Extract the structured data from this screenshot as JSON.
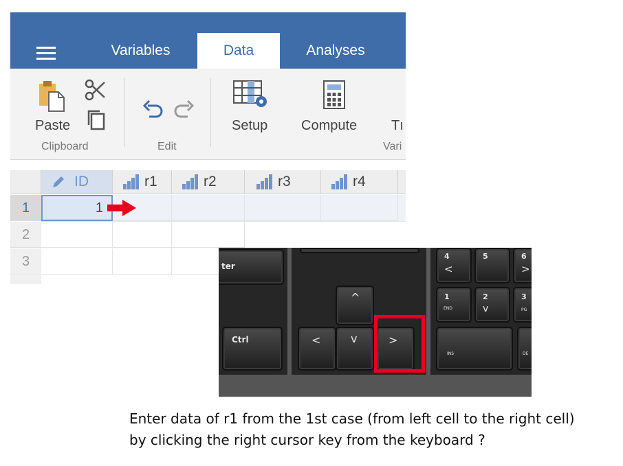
{
  "tabs": {
    "variables": "Variables",
    "data": "Data",
    "analyses": "Analyses"
  },
  "ribbon": {
    "paste": "Paste",
    "clipboard_group": "Clipboard",
    "edit_group": "Edit",
    "setup": "Setup",
    "compute": "Compute",
    "truncated_button": "Tı",
    "truncated_group": "Vari"
  },
  "grid": {
    "columns": [
      "ID",
      "r1",
      "r2",
      "r3",
      "r4"
    ],
    "rows": [
      "1",
      "2",
      "3"
    ],
    "cell_1_id": "1"
  },
  "keyboard": {
    "enter_partial": "ter",
    "ctrl": "Ctrl",
    "up": "^",
    "down": "v",
    "left": "<",
    "right": ">",
    "np4": "4",
    "np5": "5",
    "np6": "6",
    "np1": "1",
    "np2": "2",
    "np3": "3",
    "np4_sub": "<",
    "np6_sub": ">",
    "np1_sub": "END",
    "np2_sub": "v",
    "np3_sub": "PG",
    "np0_sub": "INS",
    "del_sub": "DE"
  },
  "caption": {
    "line1": "Enter data of r1 from the 1st case (from left cell to the right cell)",
    "line2": "by clicking the right cursor key from the keyboard ?"
  },
  "colors": {
    "topbar": "#3e6da9",
    "highlight": "#e8001c",
    "arrow": "#e8001c",
    "selected_cell": "#dce7f5"
  }
}
